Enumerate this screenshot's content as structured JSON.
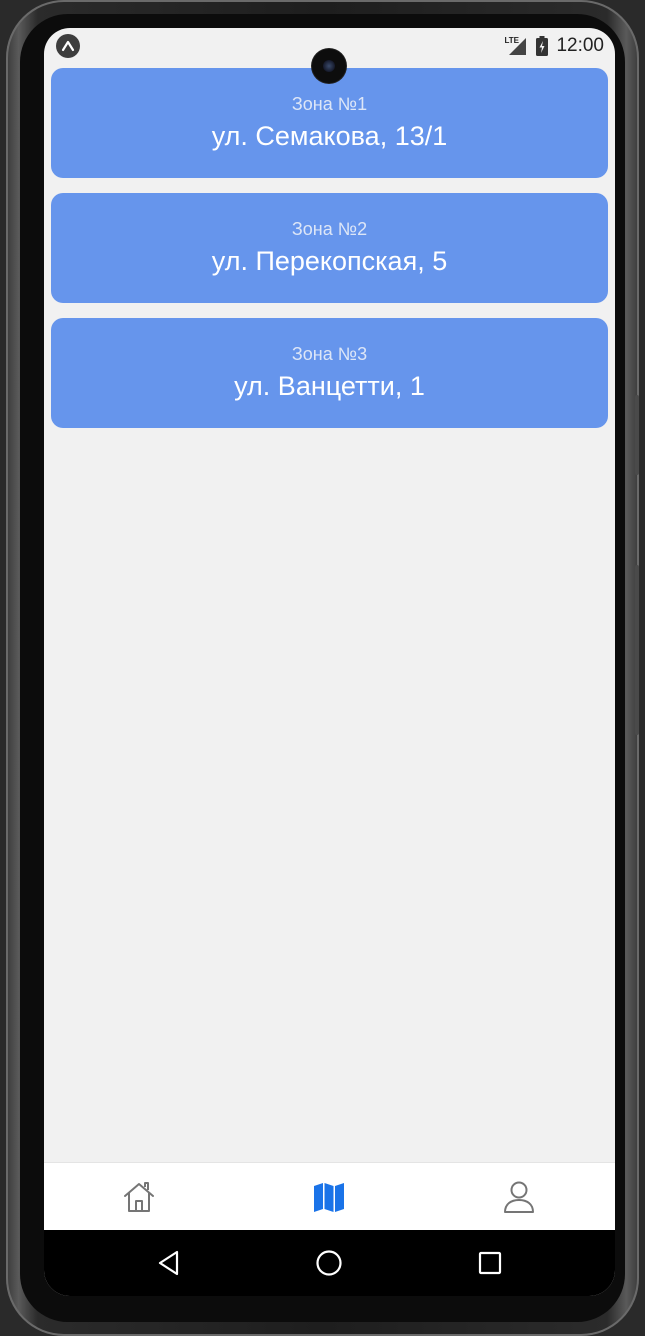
{
  "status_bar": {
    "time": "12:00",
    "network": "LTE",
    "app_icon": "expo-icon"
  },
  "zones": [
    {
      "title": "Зона №1",
      "address": "ул. Семакова, 13/1"
    },
    {
      "title": "Зона №2",
      "address": "ул. Перекопская, 5"
    },
    {
      "title": "Зона №3",
      "address": "ул. Ванцетти, 1"
    }
  ],
  "tab_bar": {
    "tabs": [
      {
        "icon": "home-icon",
        "active": false
      },
      {
        "icon": "map-icon",
        "active": true
      },
      {
        "icon": "profile-icon",
        "active": false
      }
    ]
  },
  "nav_bar": {
    "buttons": [
      "back-icon",
      "home-circle-icon",
      "recents-icon"
    ]
  },
  "colors": {
    "card": "#6695ec",
    "screen_background": "#f1f1f1",
    "tab_active": "#1a73e8",
    "tab_inactive": "#757575"
  }
}
